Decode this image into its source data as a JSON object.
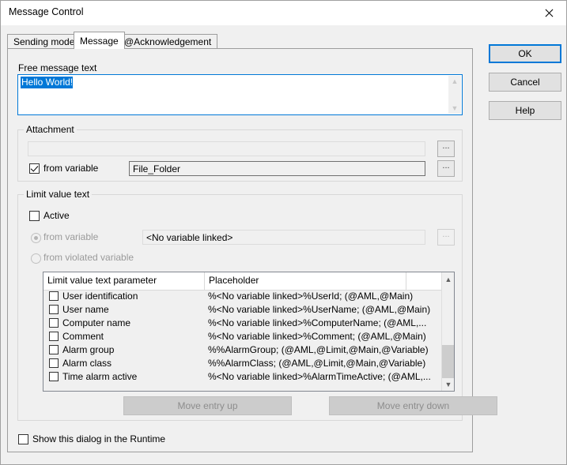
{
  "window": {
    "title": "Message Control",
    "close_icon": "close-icon"
  },
  "tabs": [
    {
      "label": "Sending mode",
      "active": false
    },
    {
      "label": "Message",
      "active": true
    },
    {
      "label": "@Acknowledgement",
      "active": false
    }
  ],
  "free_message": {
    "label": "Free message text",
    "value": "Hello World!",
    "selected": true,
    "scroll_up_icon": "chevron-up-icon",
    "scroll_down_icon": "chevron-down-icon"
  },
  "attachment": {
    "group_title": "Attachment",
    "path_value": "",
    "browse_label": "...",
    "from_variable_label": "from variable",
    "from_variable_checked": true,
    "variable_value": "File_Folder",
    "variable_browse_label": "..."
  },
  "limit_value_text": {
    "group_title": "Limit value text",
    "active_label": "Active",
    "active_checked": false,
    "from_variable_label": "from variable",
    "from_variable_selected": true,
    "from_violated_variable_label": "from violated variable",
    "from_violated_variable_selected": false,
    "variable_value": "<No variable linked>",
    "variable_browse_label": "...",
    "columns": [
      "Limit value text parameter",
      "Placeholder",
      ""
    ],
    "rows": [
      {
        "checked": false,
        "parameter": "User identification",
        "placeholder": "%<No variable linked>%UserId; (@AML,@Main)"
      },
      {
        "checked": false,
        "parameter": "User name",
        "placeholder": "%<No variable linked>%UserName; (@AML,@Main)"
      },
      {
        "checked": false,
        "parameter": "Computer name",
        "placeholder": "%<No variable linked>%ComputerName; (@AML,..."
      },
      {
        "checked": false,
        "parameter": "Comment",
        "placeholder": "%<No variable linked>%Comment; (@AML,@Main)"
      },
      {
        "checked": false,
        "parameter": "Alarm group",
        "placeholder": "%%AlarmGroup; (@AML,@Limit,@Main,@Variable)"
      },
      {
        "checked": false,
        "parameter": "Alarm class",
        "placeholder": "%%AlarmClass; (@AML,@Limit,@Main,@Variable)"
      },
      {
        "checked": false,
        "parameter": "Time alarm active",
        "placeholder": "%<No variable linked>%AlarmTimeActive; (@AML,..."
      }
    ],
    "scroll_up_icon": "chevron-up-icon",
    "scroll_down_icon": "chevron-down-icon",
    "move_entry_up_label": "Move entry up",
    "move_entry_down_label": "Move entry down"
  },
  "footer": {
    "show_in_runtime_label": "Show this dialog in the Runtime",
    "show_in_runtime_checked": false
  },
  "buttons": {
    "ok": "OK",
    "cancel": "Cancel",
    "help": "Help"
  },
  "colors": {
    "accent": "#0078d7",
    "dialog_bg": "#f0f0f0",
    "disabled_text": "#9a9a9a"
  }
}
